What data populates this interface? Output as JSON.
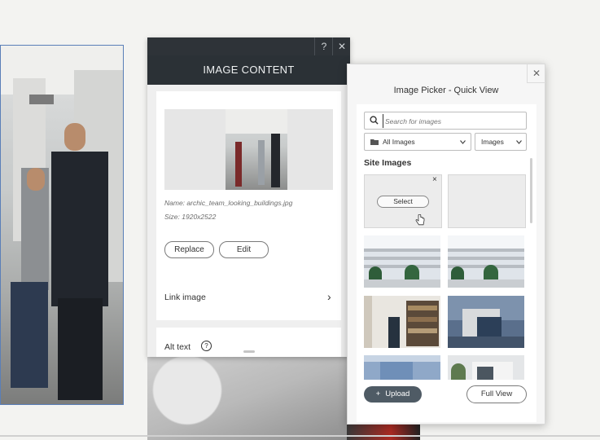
{
  "image_content": {
    "help_label": "?",
    "close_label": "✕",
    "title": "IMAGE CONTENT",
    "file_name": "Name: archic_team_looking_buildings.jpg",
    "file_size": "Size: 1920x2522",
    "replace_label": "Replace",
    "edit_label": "Edit",
    "link_image_label": "Link image",
    "link_chevron": "›",
    "alt_text_label": "Alt text",
    "alt_help": "?"
  },
  "picker": {
    "title": "Image Picker - Quick View",
    "close_label": "✕",
    "search_placeholder": "Search for images",
    "filter_selected": "All Images",
    "type_selected": "Images",
    "section_title": "Site Images",
    "select_label": "Select",
    "tile_close": "×",
    "upload_label": "Upload",
    "upload_plus": "+",
    "full_view_label": "Full View"
  },
  "colors": {
    "dark_header": "#2b3136",
    "accent_button": "#4f5b65",
    "selection_border": "#5a7fb8"
  },
  "icons": {
    "search": "search-icon",
    "folder": "folder-icon",
    "chevron": "chevron-down-icon",
    "cursor": "hand-cursor-icon"
  }
}
